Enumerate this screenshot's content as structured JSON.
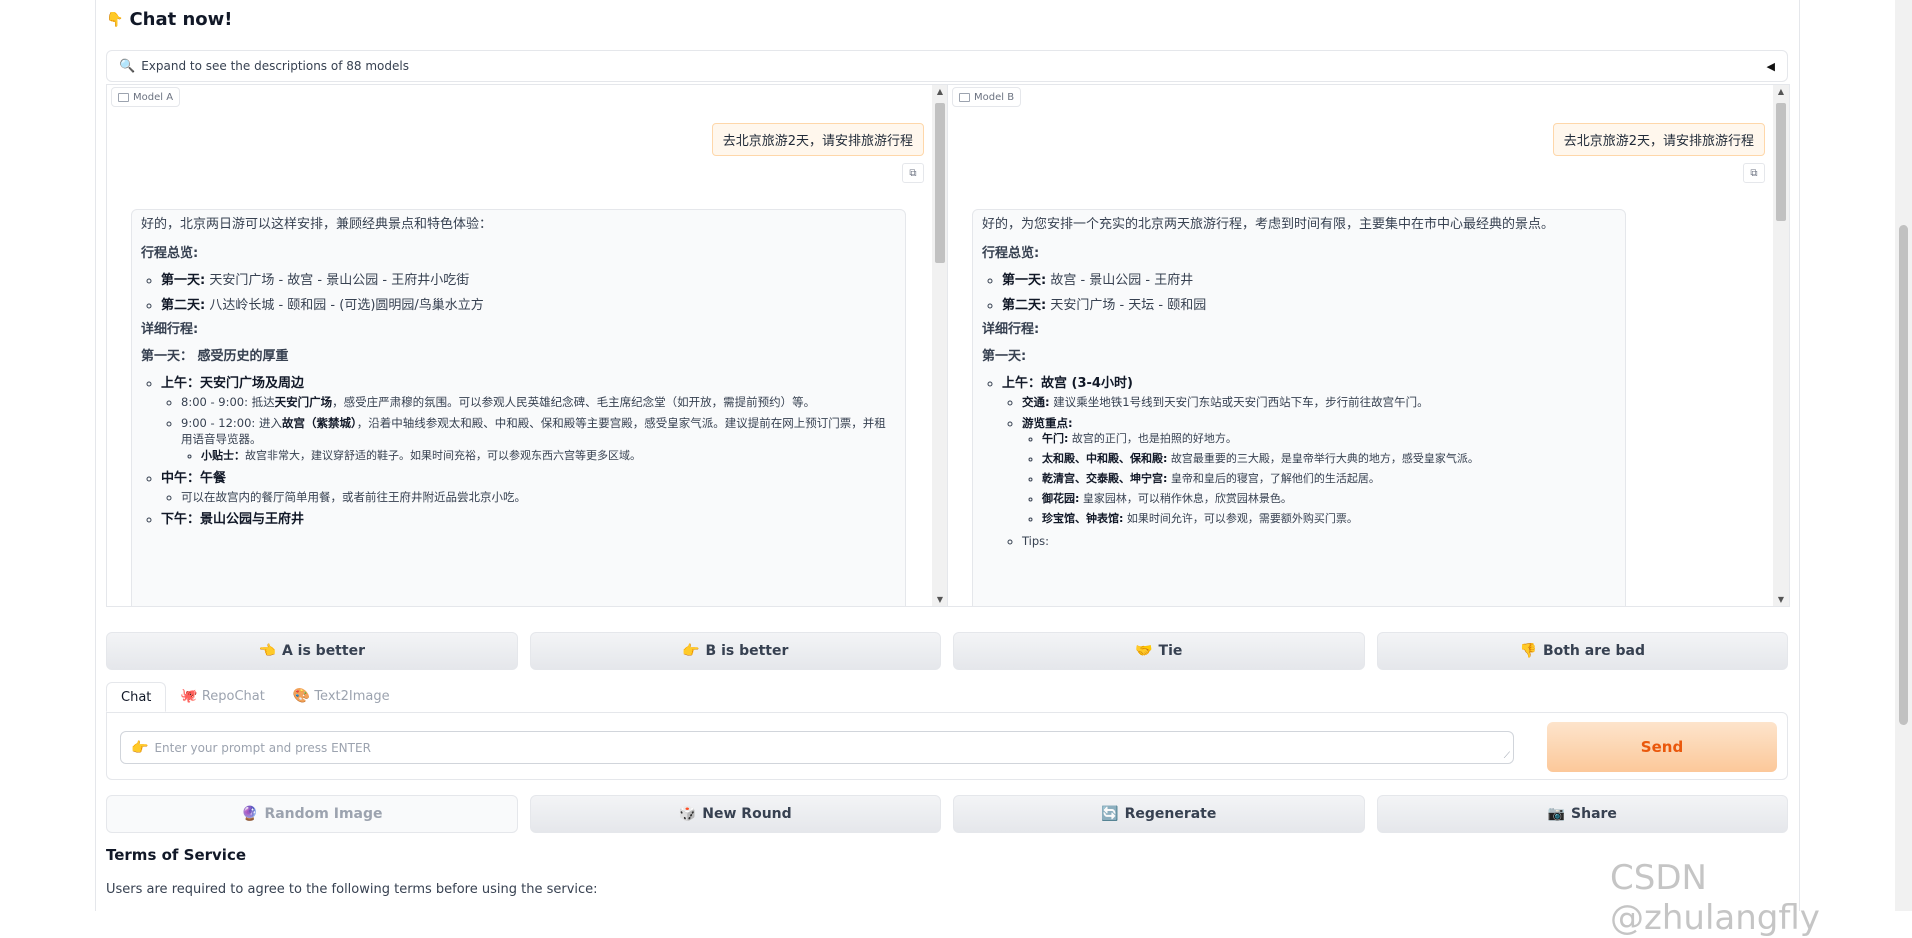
{
  "header": {
    "title": "Chat now!",
    "icon": "pointing-down-hand-icon"
  },
  "accordion": {
    "label": "Expand to see the descriptions of 88 models",
    "icon": "magnifier-icon",
    "caret_glyph": "◀"
  },
  "model_a": {
    "label": "Model A",
    "user_message": "去北京旅游2天，请安排旅游行程",
    "reply": {
      "intro": "好的，北京两日游可以这样安排，兼顾经典景点和特色体验：",
      "overview_title": "行程总览:",
      "overview": [
        {
          "day": "第一天:",
          "text": " 天安门广场 - 故宫 - 景山公园 - 王府井小吃街"
        },
        {
          "day": "第二天:",
          "text": " 八达岭长城 - 颐和园 - (可选)圆明园/鸟巢水立方"
        }
      ],
      "detail_title": "详细行程:",
      "day1_title": "第一天： 感受历史的厚重",
      "morning_title": "上午：天安门广场及周边",
      "morning_items": [
        {
          "pre": "8:00 - 9:00: 抵达",
          "bold": "天安门广场",
          "post": "，感受庄严肃穆的氛围。可以参观人民英雄纪念碑、毛主席纪念堂（如开放，需提前预约）等。"
        },
        {
          "pre": "9:00 - 12:00: 进入",
          "bold": "故宫（紫禁城）",
          "post": "，沿着中轴线参观太和殿、中和殿、保和殿等主要宫殿，感受皇家气派。建议提前在网上预订门票，并租用语音导览器。"
        }
      ],
      "tip_label": "小贴士：",
      "tip_text": "故宫非常大，建议穿舒适的鞋子。如果时间充裕，可以参观东西六宫等更多区域。",
      "noon_title": "中午：午餐",
      "noon_text": "可以在故宫内的餐厅简单用餐，或者前往王府井附近品尝北京小吃。",
      "afternoon_title": "下午：景山公园与王府井"
    }
  },
  "model_b": {
    "label": "Model B",
    "user_message": "去北京旅游2天，请安排旅游行程",
    "reply": {
      "intro": "好的，为您安排一个充实的北京两天旅游行程，考虑到时间有限，主要集中在市中心最经典的景点。",
      "overview_title": "行程总览:",
      "overview": [
        {
          "day": "第一天:",
          "text": " 故宫 - 景山公园 - 王府井"
        },
        {
          "day": "第二天:",
          "text": " 天安门广场 - 天坛 - 颐和园"
        }
      ],
      "detail_title": "详细行程:",
      "day1_title": "第一天:",
      "morning_title": "上午：故宫 (3-4小时)",
      "transport_label": "交通:",
      "transport_text": " 建议乘坐地铁1号线到天安门东站或天安门西站下车，步行前往故宫午门。",
      "highlights_label": "游览重点:",
      "highlights": [
        {
          "name": "午门:",
          "text": " 故宫的正门，也是拍照的好地方。"
        },
        {
          "name": "太和殿、中和殿、保和殿:",
          "text": " 故宫最重要的三大殿，是皇帝举行大典的地方，感受皇家气派。"
        },
        {
          "name": "乾清宫、交泰殿、坤宁宫:",
          "text": " 皇帝和皇后的寝宫，了解他们的生活起居。"
        },
        {
          "name": "御花园:",
          "text": " 皇家园林，可以稍作休息，欣赏园林景色。"
        },
        {
          "name": "珍宝馆、钟表馆:",
          "text": " 如果时间允许，可以参观，需要额外购买门票。"
        }
      ],
      "tips_label": "Tips:"
    }
  },
  "vote_buttons": [
    {
      "label": "A is better",
      "icon": "hand-pointing-left-icon",
      "glyph": "👈"
    },
    {
      "label": "B is better",
      "icon": "hand-pointing-right-icon",
      "glyph": "👉"
    },
    {
      "label": "Tie",
      "icon": "handshake-icon",
      "glyph": "🤝"
    },
    {
      "label": "Both are bad",
      "icon": "thumbs-down-icon",
      "glyph": "👎"
    }
  ],
  "tabs": [
    {
      "label": "Chat",
      "active": true
    },
    {
      "label": "RepoChat",
      "glyph": "🐙"
    },
    {
      "label": "Text2Image",
      "glyph": "🎨"
    }
  ],
  "prompt": {
    "placeholder": "Enter your prompt and press ENTER",
    "glyph": "👉"
  },
  "send_label": "Send",
  "action_buttons": [
    {
      "label": "Random Image",
      "icon": "dice-icon",
      "glyph": "🔮",
      "disabled": true
    },
    {
      "label": "New Round",
      "icon": "new-round-icon",
      "glyph": "🎲"
    },
    {
      "label": "Regenerate",
      "icon": "refresh-icon",
      "glyph": "🔄"
    },
    {
      "label": "Share",
      "icon": "camera-icon",
      "glyph": "📷"
    }
  ],
  "terms": {
    "title": "Terms of Service",
    "text": "Users are required to agree to the following terms before using the service:"
  },
  "watermark": "CSDN @zhulangfly"
}
